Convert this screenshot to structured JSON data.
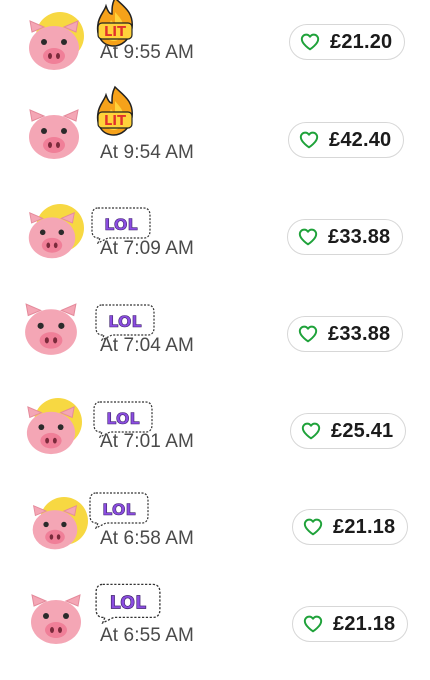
{
  "colors": {
    "heart_outline": "#1fa23a",
    "pill_border": "#d7d7d7",
    "pig_pink": "#f4a6b5",
    "halo_yellow": "#f7d842",
    "lol_purple": "#8b4de0",
    "lit_red": "#e0322c",
    "lit_orange": "#f6a21a"
  },
  "tips": [
    {
      "avatar_icon": "pig-face-icon",
      "sticker": "LIT",
      "time": "At 9:55 AM",
      "amount": "£21.20"
    },
    {
      "avatar_icon": "pig-face-icon",
      "sticker": "LIT",
      "time": "At 9:54 AM",
      "amount": "£42.40"
    },
    {
      "avatar_icon": "pig-face-icon",
      "sticker": "LOL",
      "time": "At 7:09 AM",
      "amount": "£33.88"
    },
    {
      "avatar_icon": "pig-face-icon",
      "sticker": "LOL",
      "time": "At 7:04 AM",
      "amount": "£33.88"
    },
    {
      "avatar_icon": "pig-face-icon",
      "sticker": "LOL",
      "time": "At 7:01 AM",
      "amount": "£25.41"
    },
    {
      "avatar_icon": "pig-face-icon",
      "sticker": "LOL",
      "time": "At 6:58 AM",
      "amount": "£21.18"
    },
    {
      "avatar_icon": "pig-face-icon",
      "sticker": "LOL",
      "time": "At 6:55 AM",
      "amount": "£21.18"
    }
  ]
}
